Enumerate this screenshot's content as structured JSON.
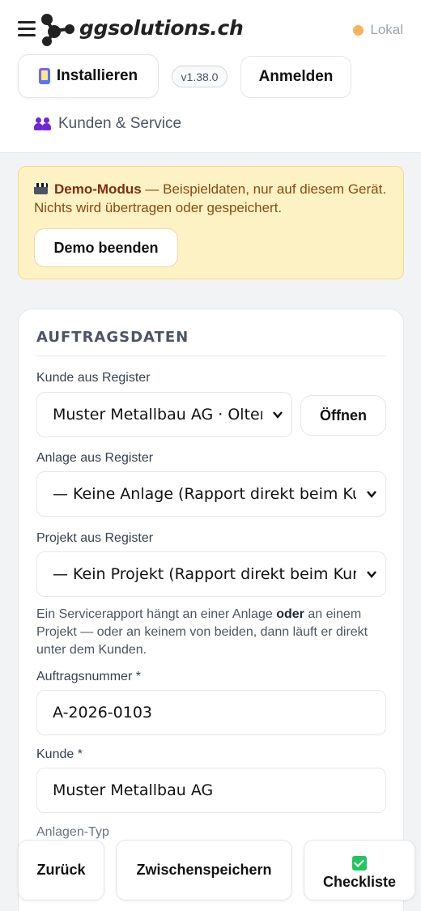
{
  "header": {
    "brand": "ggsolutions.ch",
    "status": "Lokal",
    "install_label": "Installieren",
    "version": "v1.38.0",
    "login_label": "Anmelden",
    "nav_link": "Kunden & Service"
  },
  "demo": {
    "title": "Demo-Modus",
    "text": " — Beispieldaten, nur auf diesem Gerät. Nichts wird übertragen oder gespeichert.",
    "end_label": "Demo beenden"
  },
  "form": {
    "section_title": "AUFTRAGSDATEN",
    "kunde_register_label": "Kunde aus Register",
    "kunde_register_value": "Muster Metallbau AG · Olten",
    "open_label": "Öffnen",
    "anlage_register_label": "Anlage aus Register",
    "anlage_register_value": "— Keine Anlage (Rapport direkt beim Kunden)",
    "projekt_register_label": "Projekt aus Register",
    "projekt_register_value": "— Kein Projekt (Rapport direkt beim Kunden)",
    "helper_1": "Ein Servicerapport hängt an einer Anlage ",
    "helper_bold": "oder",
    "helper_2": " an einem Projekt — oder an keinem von beiden, dann läuft er direkt unter dem Kunden.",
    "auftragsnummer_label": "Auftragsnummer *",
    "auftragsnummer_value": "A-2026-0103",
    "kunde_label": "Kunde *",
    "kunde_value": "Muster Metallbau AG",
    "anlagen_typ_label": "Anlagen-Typ"
  },
  "footer": {
    "back_label": "Zurück",
    "save_label": "Zwischenspeichern",
    "checklist_label": "Checkliste"
  },
  "colors": {
    "status_dot": "#f6b35b",
    "demo_bg": "#fdf2c4",
    "demo_text": "#8a4b0f",
    "checklist_icon": "#22c55e"
  }
}
